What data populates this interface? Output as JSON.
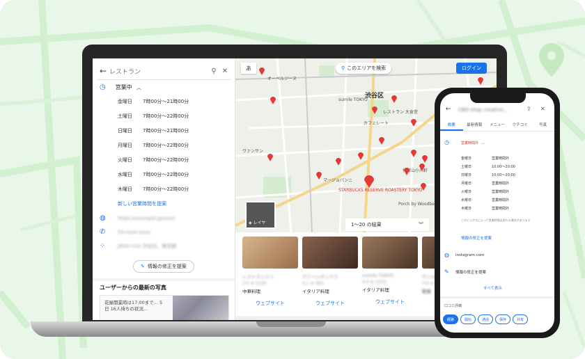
{
  "left_panel": {
    "search_placeholder": "レストラン",
    "hours_status": "営業中",
    "hours": [
      {
        "day": "金曜日",
        "time": "7時00分～21時00分"
      },
      {
        "day": "土曜日",
        "time": "7時00分～22時00分"
      },
      {
        "day": "日曜日",
        "time": "7時00分～21時00分"
      },
      {
        "day": "月曜日",
        "time": "7時00分～22時00分"
      },
      {
        "day": "火曜日",
        "time": "7時00分～22時00分"
      },
      {
        "day": "水曜日",
        "time": "7時00分～22時00分"
      },
      {
        "day": "木曜日",
        "time": "7時00分～22時00分"
      }
    ],
    "new_hours_link": "新しい営業時間を提案",
    "website_blurred": "https://example.jp/xxxx",
    "phone_blurred": "03-xxxx-xxxx",
    "pluscode_blurred": "JMXX+XX 渋谷区、東京都",
    "suggest_edit": "情報の修正を提案",
    "photos_heading": "ユーザーからの最新の写真",
    "photo_caption": "花屋開業時は17:00まで... 5日 16人待ちの状況..."
  },
  "map": {
    "lang_button": "あ",
    "search_area": "このエリアを検索",
    "login": "ログイン",
    "labels": {
      "shibuya": "渋谷区",
      "sumile": "sumile TOKYO",
      "restaurant": "レストラン 大食堂",
      "cafe": "カフェレート",
      "starbucks": "STARBUCKS RESERVE ROASTERY TOKYO",
      "vansan": "ヴァンサン",
      "mag": "マージョパンニ",
      "oveljume": "オーベルジーヌ",
      "pulp": "Porch by Woodberry Coffee Roasters",
      "koyo": "代官山小川軒"
    },
    "layer_label": "レイヤ",
    "results_text": "1〜20 の結果",
    "chevrons": "︾"
  },
  "cards": [
    {
      "name": "レストランミリ",
      "rating": "3.5 ★ (120)",
      "category": "中華料理",
      "web": "ウェブサイト",
      "color": "#c79a6b"
    },
    {
      "name": "グリーンボックス",
      "rating": "4.1 ★ (84)",
      "category": "イタリア料理",
      "web": "ウェブサイト",
      "color": "#6b4a3a"
    },
    {
      "name": "sumile TOKYO",
      "rating": "4.0 ★ (210)",
      "category": "イタリア料理",
      "web": "ウェブサイト",
      "color": "#7a5b44"
    },
    {
      "name": "サンセットダイナー",
      "rating": "3.9 ★ (95)",
      "category": "和食",
      "web": "ウェブサイト",
      "color": "#5e4536"
    }
  ],
  "phone": {
    "title": "CBD shop creative...",
    "tabs": [
      "概要",
      "最新情報",
      "メニュー",
      "クチコミ",
      "写真"
    ],
    "hours_status": "営業時間外",
    "hours_header_day": "金曜日",
    "hours_header_time": "営業時間外",
    "hours": [
      {
        "day": "土曜日",
        "time": "10:00～20:00"
      },
      {
        "day": "日曜日",
        "time": "10:00～20:00"
      },
      {
        "day": "月曜日",
        "time": "営業時間外"
      },
      {
        "day": "火曜日",
        "time": "営業時間外"
      },
      {
        "day": "水曜日",
        "time": "営業時間外"
      },
      {
        "day": "木曜日",
        "time": "営業時間外"
      }
    ],
    "hours_note": "このビジネスによって営業時間は変わる場合があります",
    "suggest_link": "情報の修正を提案",
    "instagram": "instagram.com",
    "edit_info": "情報の修正を提案",
    "show_all": "すべて表示",
    "reviews": "口コミ評価",
    "actions": [
      "経路",
      "開始",
      "通話",
      "保存",
      "共有"
    ]
  }
}
